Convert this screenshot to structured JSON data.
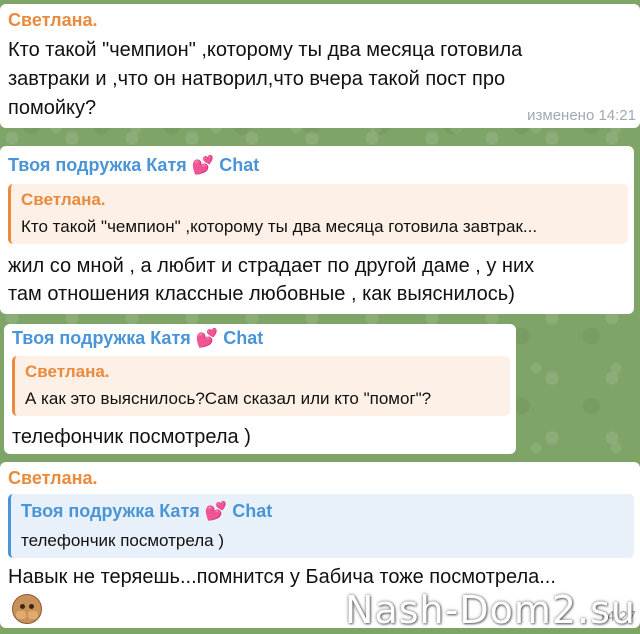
{
  "messages": [
    {
      "sender": "Светлана.",
      "lines": [
        "Кто такой \"чемпион\" ,которому ты два месяца готовила",
        "завтраки и ,что он натворил,что вчера такой пост про",
        "помойку?"
      ],
      "meta": "изменено 14:21"
    },
    {
      "sender": "Твоя подружка Катя",
      "sender_heart": "💕",
      "sender_suffix": "Chat",
      "reply_to": {
        "sender": "Светлана.",
        "text": "Кто такой \"чемпион\" ,которому ты два месяца готовила завтрак..."
      },
      "lines": [
        "жил со мной , а любит и страдает по другой даме , у них",
        "там отношения классные любовные , как выяснилось)"
      ]
    },
    {
      "sender": "Твоя подружка Катя",
      "sender_heart": "💕",
      "sender_suffix": "Chat",
      "reply_to": {
        "sender": "Светлана.",
        "text": "А как это выяснилось?Сам сказал или кто \"помог\"?"
      },
      "lines": [
        "телефончик посмотрела )"
      ]
    },
    {
      "sender": "Светлана.",
      "reply_to": {
        "sender": "Твоя подружка Катя",
        "sender_heart": "💕",
        "sender_suffix": "Chat",
        "text": "телефончик посмотрела )"
      },
      "lines": [
        "Навык  не теряешь...помнится у Бабича тоже посмотрела..."
      ],
      "emoji": "see-no-evil-monkey",
      "meta": "14:27"
    }
  ],
  "watermark": "Nash-Dom2.su",
  "colors": {
    "orange": "#e98a3c",
    "blue": "#4a95d8",
    "background": "#7fa468"
  }
}
